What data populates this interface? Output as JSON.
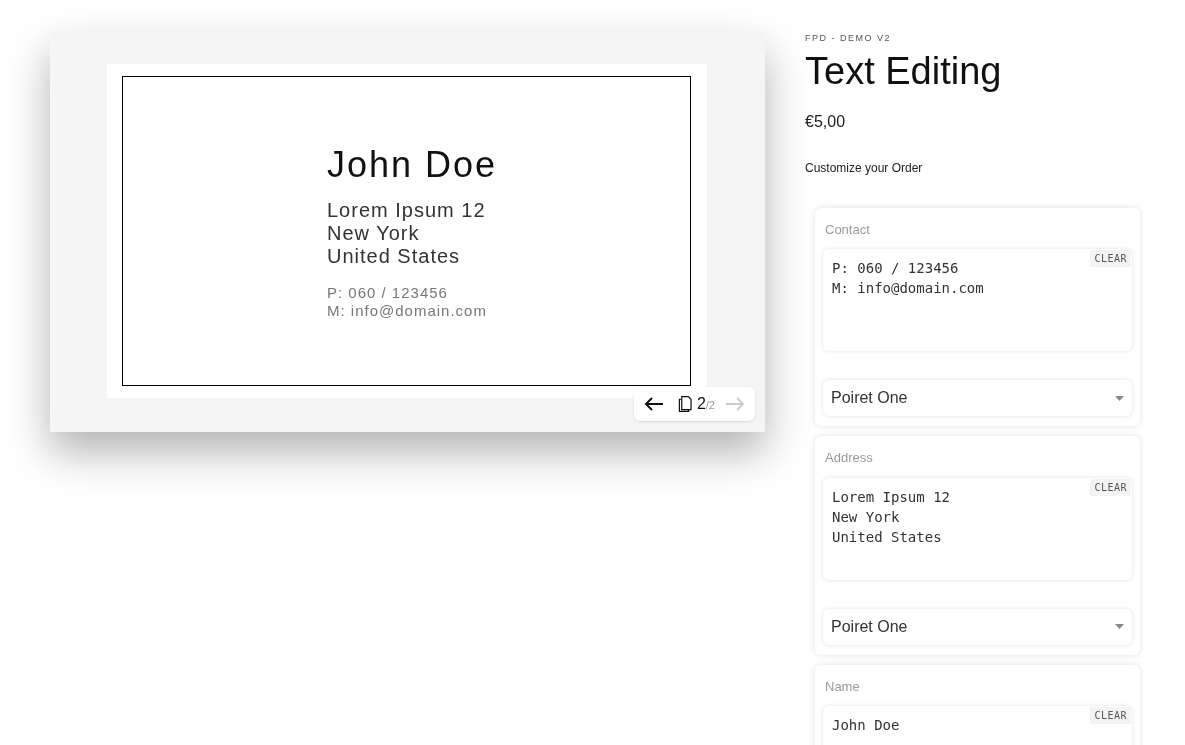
{
  "canvas": {
    "name": "John Doe",
    "address": [
      "Lorem Ipsum 12",
      "New York",
      "United States"
    ],
    "contact": [
      "P: 060 / 123456",
      "M: info@domain.com"
    ]
  },
  "pager": {
    "current": "2",
    "total": "/2",
    "prev_disabled": false,
    "next_disabled": true
  },
  "product": {
    "breadcrumb": "FPD - DEMO V2",
    "title": "Text Editing",
    "price": "€5,00",
    "subtitle": "Customize your Order"
  },
  "fields": [
    {
      "label": "Contact",
      "value": "P: 060 / 123456\nM: info@domain.com",
      "clear": "CLEAR",
      "font": "Poiret One"
    },
    {
      "label": "Address",
      "value": "Lorem Ipsum 12\nNew York\nUnited States",
      "clear": "CLEAR",
      "font": "Poiret One"
    },
    {
      "label": "Name",
      "value": "John Doe",
      "clear": "CLEAR"
    }
  ]
}
